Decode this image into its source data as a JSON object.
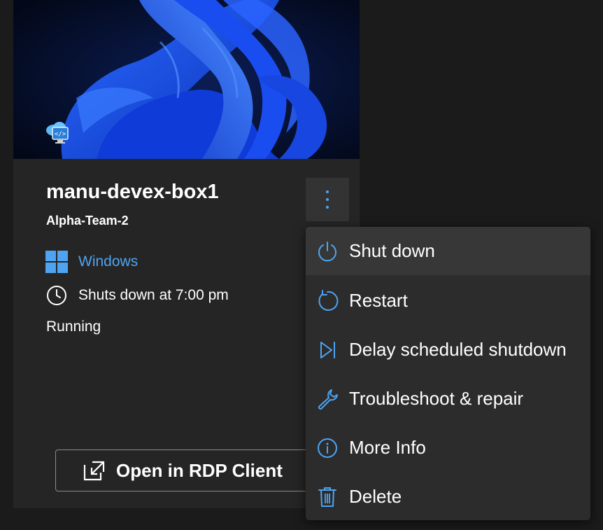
{
  "card": {
    "name": "manu-devex-box1",
    "project": "Alpha-Team-2",
    "os_label": "Windows",
    "schedule_text": "Shuts down at 7:00 pm",
    "status": "Running",
    "open_button_label": "Open in RDP Client"
  },
  "menu": {
    "items": [
      {
        "label": "Shut down",
        "icon": "power-icon"
      },
      {
        "label": "Restart",
        "icon": "restart-icon"
      },
      {
        "label": "Delay scheduled shutdown",
        "icon": "skip-forward-icon"
      },
      {
        "label": "Troubleshoot & repair",
        "icon": "wrench-icon"
      },
      {
        "label": "More Info",
        "icon": "info-icon"
      },
      {
        "label": "Delete",
        "icon": "trash-icon"
      }
    ]
  },
  "colors": {
    "background": "#1b1b1b",
    "card": "#252525",
    "menu": "#2c2c2c",
    "accent": "#4ea4f2"
  }
}
